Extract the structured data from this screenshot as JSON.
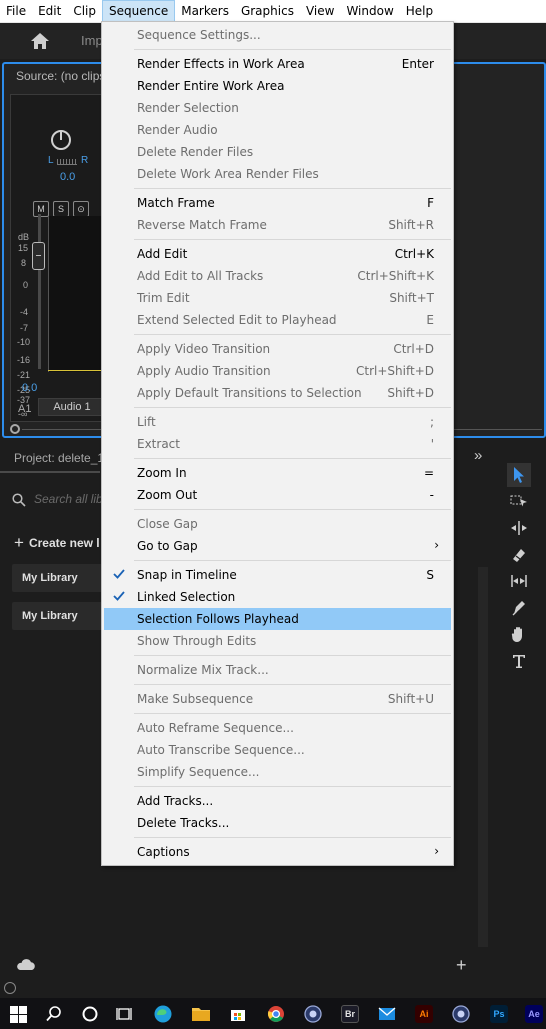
{
  "menubar": {
    "items": [
      "File",
      "Edit",
      "Clip",
      "Sequence",
      "Markers",
      "Graphics",
      "View",
      "Window",
      "Help"
    ],
    "active": "Sequence"
  },
  "header": {
    "import_tab": "Imp"
  },
  "source_panel": {
    "title": "Source: (no clips)",
    "pan_left": "L",
    "pan_right": "R",
    "pan_value": "0.0",
    "buttons": {
      "mute": "M",
      "solo": "S",
      "record": "⊙"
    },
    "db_label": "dB",
    "db_ticks": [
      "15",
      "8",
      "0",
      "-4",
      "-7",
      "-10",
      "-16",
      "-21",
      "-25",
      "-37",
      "-∞"
    ],
    "volume_value": "0.0",
    "track_id": "A1",
    "track_name": "Audio 1"
  },
  "project_panel": {
    "title": "Project: delete_1",
    "search_placeholder": "Search all libr",
    "create_new": "Create new l",
    "libraries": [
      "My Library",
      "My Library"
    ]
  },
  "sequence_menu": {
    "items": [
      {
        "label": "Sequence Settings...",
        "shortcut": "",
        "enabled": false
      },
      {
        "label": "Render Effects in Work Area",
        "shortcut": "Enter",
        "enabled": true
      },
      {
        "label": "Render Entire Work Area",
        "shortcut": "",
        "enabled": true
      },
      {
        "label": "Render Selection",
        "shortcut": "",
        "enabled": false
      },
      {
        "label": "Render Audio",
        "shortcut": "",
        "enabled": false
      },
      {
        "label": "Delete Render Files",
        "shortcut": "",
        "enabled": false
      },
      {
        "label": "Delete Work Area Render Files",
        "shortcut": "",
        "enabled": false
      },
      {
        "label": "Match Frame",
        "shortcut": "F",
        "enabled": true
      },
      {
        "label": "Reverse Match Frame",
        "shortcut": "Shift+R",
        "enabled": false
      },
      {
        "label": "Add Edit",
        "shortcut": "Ctrl+K",
        "enabled": true
      },
      {
        "label": "Add Edit to All Tracks",
        "shortcut": "Ctrl+Shift+K",
        "enabled": false
      },
      {
        "label": "Trim Edit",
        "shortcut": "Shift+T",
        "enabled": false
      },
      {
        "label": "Extend Selected Edit to Playhead",
        "shortcut": "E",
        "enabled": false
      },
      {
        "label": "Apply Video Transition",
        "shortcut": "Ctrl+D",
        "enabled": false
      },
      {
        "label": "Apply Audio Transition",
        "shortcut": "Ctrl+Shift+D",
        "enabled": false
      },
      {
        "label": "Apply Default Transitions to Selection",
        "shortcut": "Shift+D",
        "enabled": false
      },
      {
        "label": "Lift",
        "shortcut": ";",
        "enabled": false
      },
      {
        "label": "Extract",
        "shortcut": "'",
        "enabled": false
      },
      {
        "label": "Zoom In",
        "shortcut": "=",
        "enabled": true
      },
      {
        "label": "Zoom Out",
        "shortcut": "-",
        "enabled": true
      },
      {
        "label": "Close Gap",
        "shortcut": "",
        "enabled": false
      },
      {
        "label": "Go to Gap",
        "shortcut": "",
        "enabled": true,
        "submenu": true
      },
      {
        "label": "Snap in Timeline",
        "shortcut": "S",
        "enabled": true,
        "checked": true
      },
      {
        "label": "Linked Selection",
        "shortcut": "",
        "enabled": true,
        "checked": true
      },
      {
        "label": "Selection Follows Playhead",
        "shortcut": "",
        "enabled": true,
        "highlighted": true
      },
      {
        "label": "Show Through Edits",
        "shortcut": "",
        "enabled": false
      },
      {
        "label": "Normalize Mix Track...",
        "shortcut": "",
        "enabled": false
      },
      {
        "label": "Make Subsequence",
        "shortcut": "Shift+U",
        "enabled": false
      },
      {
        "label": "Auto Reframe Sequence...",
        "shortcut": "",
        "enabled": false
      },
      {
        "label": "Auto Transcribe Sequence...",
        "shortcut": "",
        "enabled": false
      },
      {
        "label": "Simplify Sequence...",
        "shortcut": "",
        "enabled": false
      },
      {
        "label": "Add Tracks...",
        "shortcut": "",
        "enabled": true
      },
      {
        "label": "Delete Tracks...",
        "shortcut": "",
        "enabled": true
      },
      {
        "label": "Captions",
        "shortcut": "",
        "enabled": true,
        "submenu": true
      }
    ]
  },
  "tools": [
    "selection-tool",
    "track-select-tool",
    "ripple-edit-tool",
    "razor-tool",
    "slip-tool",
    "pen-tool",
    "hand-tool",
    "type-tool"
  ],
  "taskbar": {
    "apps": [
      {
        "name": "start",
        "text": ""
      },
      {
        "name": "search",
        "text": ""
      },
      {
        "name": "cortana",
        "text": ""
      },
      {
        "name": "task-view",
        "text": ""
      },
      {
        "name": "edge",
        "text": ""
      },
      {
        "name": "file-explorer",
        "text": ""
      },
      {
        "name": "store",
        "text": ""
      },
      {
        "name": "chrome",
        "text": ""
      },
      {
        "name": "app-circle",
        "text": ""
      },
      {
        "name": "bridge",
        "text": "Br"
      },
      {
        "name": "mail",
        "text": ""
      },
      {
        "name": "illustrator",
        "text": "Ai"
      },
      {
        "name": "app-circle-2",
        "text": ""
      },
      {
        "name": "photoshop",
        "text": "Ps"
      },
      {
        "name": "after-effects",
        "text": "Ae"
      }
    ]
  },
  "colors": {
    "accent": "#2d8ceb",
    "menu_highlight": "#91c9f7",
    "meter_level": "#d8c238"
  }
}
